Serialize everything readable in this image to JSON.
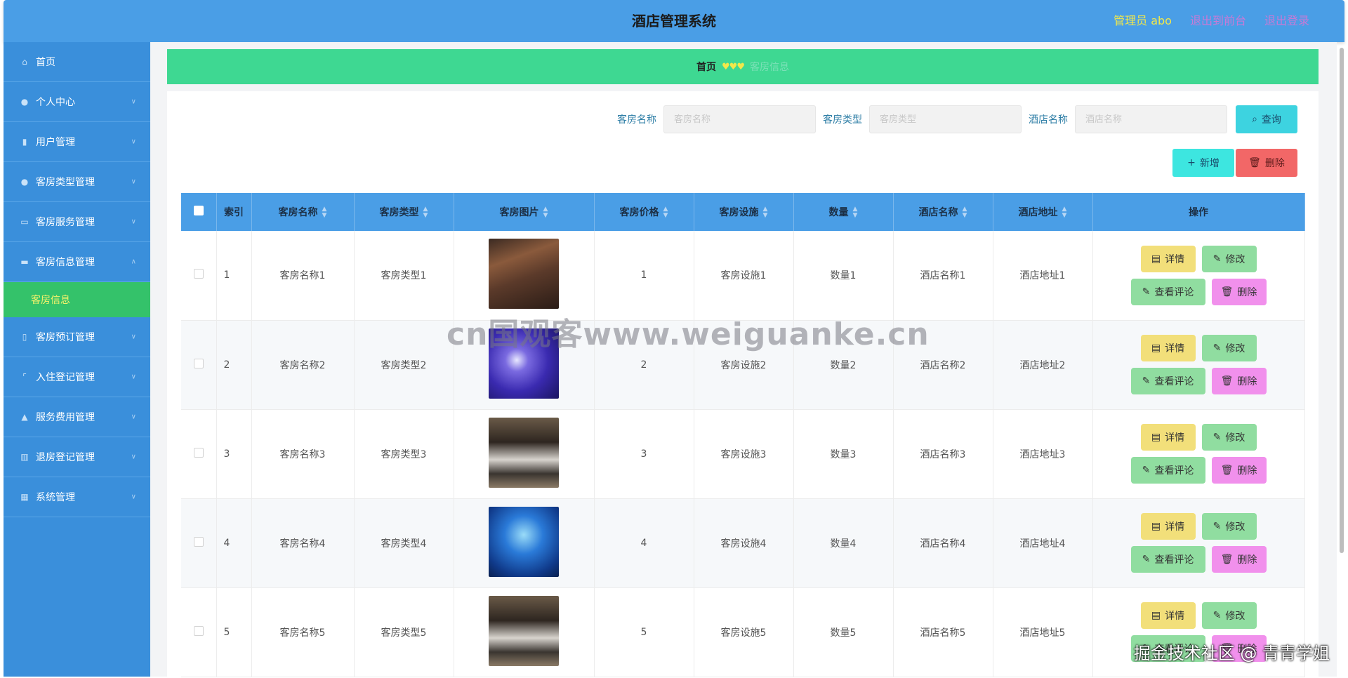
{
  "header": {
    "title": "酒店管理系统",
    "admin": "管理员 abo",
    "back_link": "退出到前台",
    "logout_link": "退出登录"
  },
  "sidebar": {
    "items": [
      {
        "label": "首页",
        "icon": "home-icon"
      },
      {
        "label": "个人中心",
        "icon": "user-icon"
      },
      {
        "label": "用户管理",
        "icon": "chart-icon"
      },
      {
        "label": "客房类型管理",
        "icon": "person-icon"
      },
      {
        "label": "客房服务管理",
        "icon": "chat-icon"
      },
      {
        "label": "客房信息管理",
        "icon": "monitor-icon",
        "expanded": true
      },
      {
        "label": "客房预订管理",
        "icon": "phone-icon"
      },
      {
        "label": "入住登记管理",
        "icon": "frame-icon"
      },
      {
        "label": "服务费用管理",
        "icon": "thumb-icon"
      },
      {
        "label": "退房登记管理",
        "icon": "building-icon"
      },
      {
        "label": "系统管理",
        "icon": "map-icon"
      }
    ],
    "submenu": {
      "label": "客房信息"
    }
  },
  "breadcrumb": {
    "home": "首页",
    "hearts": "♥♥♥",
    "current": "客房信息"
  },
  "search": {
    "room_name_label": "客房名称",
    "room_name_placeholder": "客房名称",
    "room_type_label": "客房类型",
    "room_type_placeholder": "客房类型",
    "hotel_name_label": "酒店名称",
    "hotel_name_placeholder": "酒店名称",
    "query_label": "查询"
  },
  "actions": {
    "add_label": "新增",
    "delete_label": "删除"
  },
  "table": {
    "headers": {
      "index": "索引",
      "room_name": "客房名称",
      "room_type": "客房类型",
      "room_image": "客房图片",
      "room_price": "客房价格",
      "facilities": "客房设施",
      "quantity": "数量",
      "hotel_name": "酒店名称",
      "hotel_address": "酒店地址",
      "ops": "操作"
    },
    "rows": [
      {
        "index": "1",
        "room_name": "客房名称1",
        "room_type": "客房类型1",
        "price": "1",
        "facilities": "客房设施1",
        "quantity": "数量1",
        "hotel_name": "酒店名称1",
        "hotel_address": "酒店地址1"
      },
      {
        "index": "2",
        "room_name": "客房名称2",
        "room_type": "客房类型2",
        "price": "2",
        "facilities": "客房设施2",
        "quantity": "数量2",
        "hotel_name": "酒店名称2",
        "hotel_address": "酒店地址2"
      },
      {
        "index": "3",
        "room_name": "客房名称3",
        "room_type": "客房类型3",
        "price": "3",
        "facilities": "客房设施3",
        "quantity": "数量3",
        "hotel_name": "酒店名称3",
        "hotel_address": "酒店地址3"
      },
      {
        "index": "4",
        "room_name": "客房名称4",
        "room_type": "客房类型4",
        "price": "4",
        "facilities": "客房设施4",
        "quantity": "数量4",
        "hotel_name": "酒店名称4",
        "hotel_address": "酒店地址4"
      },
      {
        "index": "5",
        "room_name": "客房名称5",
        "room_type": "客房类型5",
        "price": "5",
        "facilities": "客房设施5",
        "quantity": "数量5",
        "hotel_name": "酒店名称5",
        "hotel_address": "酒店地址5"
      }
    ],
    "row_ops": {
      "detail": "详情",
      "edit": "修改",
      "review": "查看评论",
      "delete": "删除"
    }
  },
  "watermark": "cn国观客www.weiguanke.cn",
  "corner_mark": "掘金技术社区 @ 青青学姐",
  "colors": {
    "header_bg": "#4a9ee6",
    "sidebar_bg": "#3a8fdb",
    "breadcrumb_bg": "#3ed892",
    "submenu_active_bg": "#34c26a"
  }
}
